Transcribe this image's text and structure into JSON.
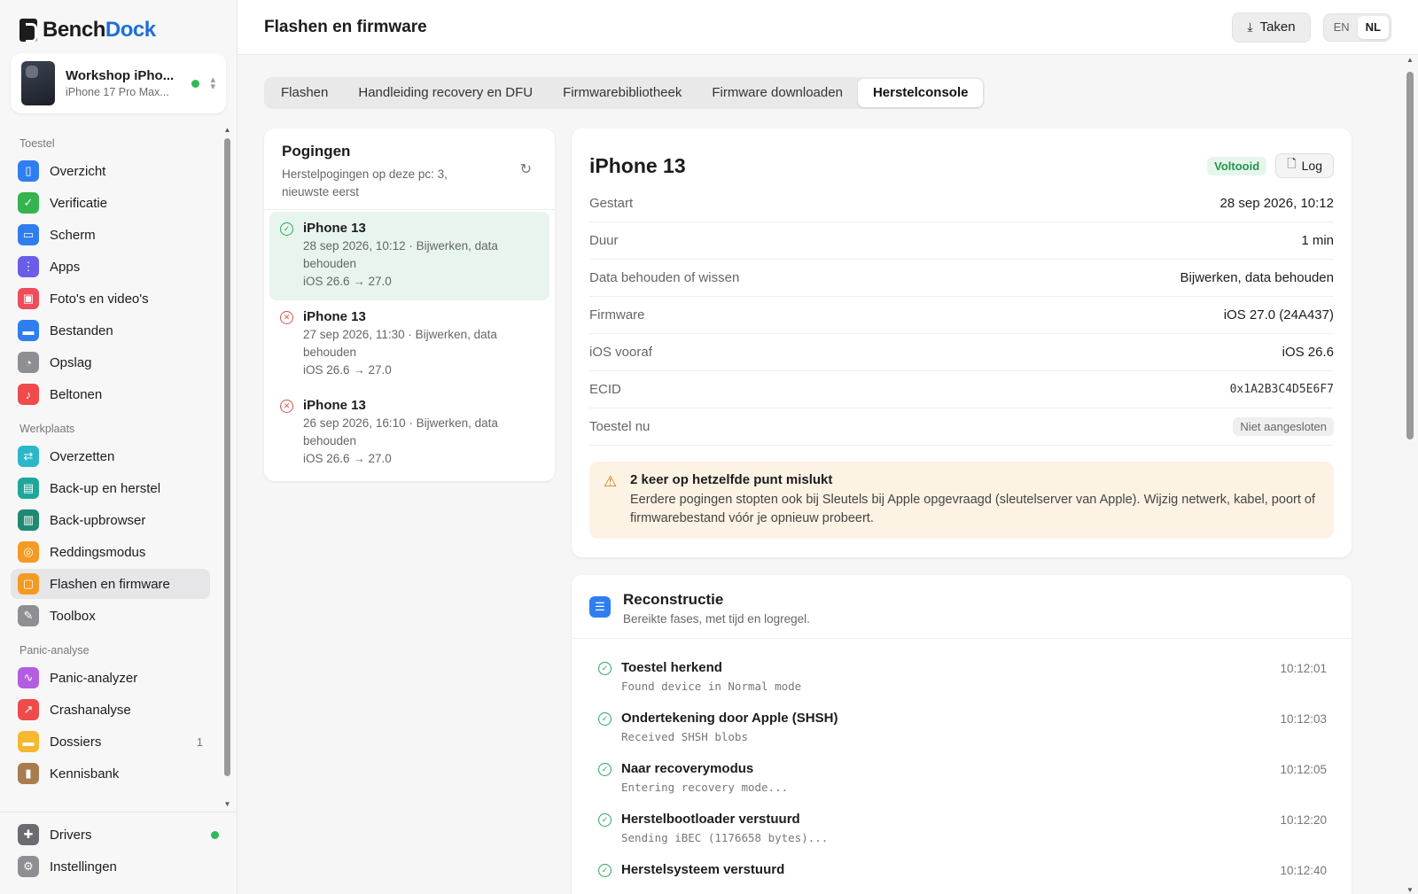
{
  "app": {
    "brand_left": "Bench",
    "brand_right": "Dock"
  },
  "device": {
    "name": "Workshop iPho...",
    "model": "iPhone 17 Pro Max...",
    "status_color": "#2dbb55"
  },
  "sidebar": {
    "sections": [
      {
        "label": "Toestel",
        "items": [
          {
            "label": "Overzicht",
            "icon": "phone-icon",
            "color": "#2f7ef0"
          },
          {
            "label": "Verificatie",
            "icon": "shield-check-icon",
            "color": "#34b34f"
          },
          {
            "label": "Scherm",
            "icon": "display-icon",
            "color": "#2f7ef0"
          },
          {
            "label": "Apps",
            "icon": "grid-icon",
            "color": "#6a5ee8"
          },
          {
            "label": "Foto's en video's",
            "icon": "photo-icon",
            "color": "#ef4b5b"
          },
          {
            "label": "Bestanden",
            "icon": "folder-icon",
            "color": "#2f7ef0"
          },
          {
            "label": "Opslag",
            "icon": "pie-chart-icon",
            "color": "#8e8e93"
          },
          {
            "label": "Beltonen",
            "icon": "music-note-icon",
            "color": "#ef4b4b"
          }
        ]
      },
      {
        "label": "Werkplaats",
        "items": [
          {
            "label": "Overzetten",
            "icon": "transfer-icon",
            "color": "#2ab7c9"
          },
          {
            "label": "Back-up en herstel",
            "icon": "archive-icon",
            "color": "#1fa69a"
          },
          {
            "label": "Back-upbrowser",
            "icon": "drawer-icon",
            "color": "#1e8a72"
          },
          {
            "label": "Reddingsmodus",
            "icon": "lifebuoy-icon",
            "color": "#f59a23"
          },
          {
            "label": "Flashen en firmware",
            "icon": "chip-icon",
            "color": "#f59a23",
            "active": true
          },
          {
            "label": "Toolbox",
            "icon": "wrench-icon",
            "color": "#8e8e93"
          }
        ]
      },
      {
        "label": "Panic-analyse",
        "items": [
          {
            "label": "Panic-analyzer",
            "icon": "waveform-icon",
            "color": "#b35de0"
          },
          {
            "label": "Crashanalyse",
            "icon": "trend-icon",
            "color": "#ef4b4b"
          },
          {
            "label": "Dossiers",
            "icon": "folder-stack-icon",
            "color": "#f5b82e",
            "count": "1"
          },
          {
            "label": "Kennisbank",
            "icon": "book-icon",
            "color": "#a87c4f"
          }
        ]
      }
    ],
    "bottom": [
      {
        "label": "Drivers",
        "icon": "puzzle-icon",
        "color": "#6b6b70",
        "status_color": "#2dbb55"
      },
      {
        "label": "Instellingen",
        "icon": "gear-icon",
        "color": "#8e8e93"
      }
    ]
  },
  "topbar": {
    "title": "Flashen en firmware",
    "tasks_label": "Taken",
    "lang_en": "EN",
    "lang_nl": "NL",
    "lang_active": "NL"
  },
  "tabs": [
    {
      "label": "Flashen"
    },
    {
      "label": "Handleiding recovery en DFU"
    },
    {
      "label": "Firmwarebibliotheek"
    },
    {
      "label": "Firmware downloaden"
    },
    {
      "label": "Herstelconsole",
      "active": true
    }
  ],
  "attempts": {
    "title": "Pogingen",
    "subtitle": "Herstelpogingen op deze pc: 3, nieuwste eerst",
    "items": [
      {
        "name": "iPhone 13",
        "meta": "28 sep 2026, 10:12 · Bijwerken, data behouden",
        "version": "iOS 26.6 → 27.0",
        "status": "ok",
        "selected": true
      },
      {
        "name": "iPhone 13",
        "meta": "27 sep 2026, 11:30 · Bijwerken, data behouden",
        "version": "iOS 26.6 → 27.0",
        "status": "error"
      },
      {
        "name": "iPhone 13",
        "meta": "26 sep 2026, 16:10 · Bijwerken, data behouden",
        "version": "iOS 26.6 → 27.0",
        "status": "error"
      }
    ]
  },
  "detail": {
    "title": "iPhone 13",
    "status_badge": "Voltooid",
    "log_label": "Log",
    "rows": [
      {
        "key": "Gestart",
        "value": "28 sep 2026, 10:12"
      },
      {
        "key": "Duur",
        "value": "1 min"
      },
      {
        "key": "Data behouden of wissen",
        "value": "Bijwerken, data behouden"
      },
      {
        "key": "Firmware",
        "value": "iOS 27.0 (24A437)"
      },
      {
        "key": "iOS vooraf",
        "value": "iOS 26.6"
      },
      {
        "key": "ECID",
        "value": "0x1A2B3C4D5E6F7",
        "mono": true
      },
      {
        "key": "Toestel nu",
        "value": "Niet aangesloten",
        "pill": true
      }
    ],
    "warning": {
      "title": "2 keer op hetzelfde punt mislukt",
      "text": "Eerdere pogingen stopten ook bij Sleutels bij Apple opgevraagd (sleutelserver van Apple). Wijzig netwerk, kabel, poort of firmwarebestand vóór je opnieuw probeert."
    }
  },
  "reconstruction": {
    "title": "Reconstructie",
    "subtitle": "Bereikte fases, met tijd en logregel.",
    "steps": [
      {
        "name": "Toestel herkend",
        "log": "Found device in Normal mode",
        "time": "10:12:01"
      },
      {
        "name": "Ondertekening door Apple (SHSH)",
        "log": "Received SHSH blobs",
        "time": "10:12:03"
      },
      {
        "name": "Naar recoverymodus",
        "log": "Entering recovery mode...",
        "time": "10:12:05"
      },
      {
        "name": "Herstelbootloader verstuurd",
        "log": "Sending iBEC (1176658 bytes)...",
        "time": "10:12:20"
      },
      {
        "name": "Herstelsysteem verstuurd",
        "log": "",
        "time": "10:12:40"
      }
    ]
  }
}
